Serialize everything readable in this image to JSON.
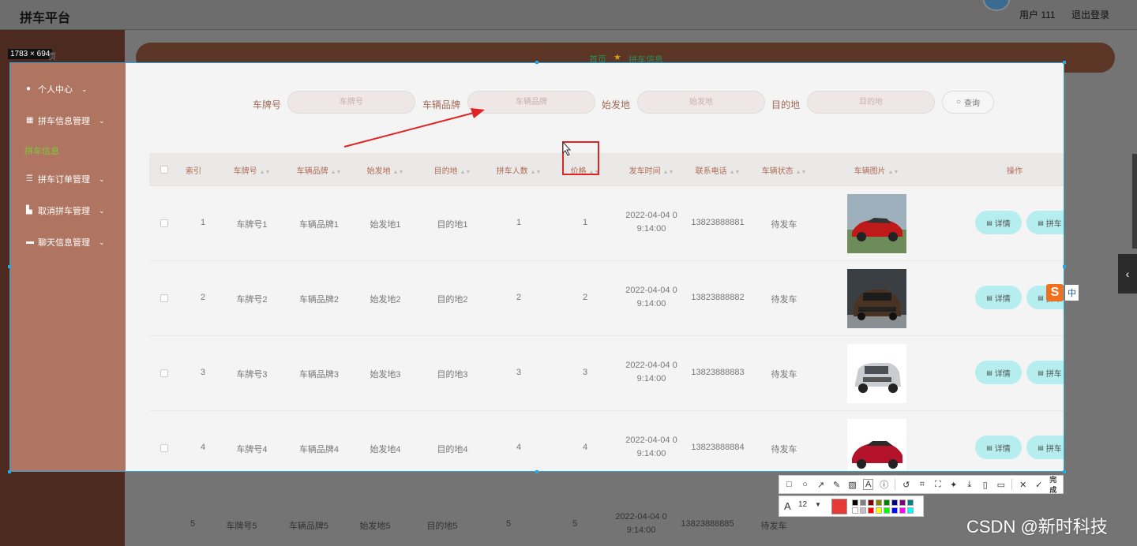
{
  "app": {
    "title": "拼车平台",
    "user": "用户 111",
    "logout": "退出登录"
  },
  "screenshot": {
    "size_label": "1783 × 694",
    "hidden_label": "页"
  },
  "breadcrumb": {
    "home": "首页",
    "current": "拼车信息"
  },
  "sidebar": {
    "items": [
      {
        "label": "个人中心",
        "icon": "user-icon"
      },
      {
        "label": "拼车信息管理",
        "icon": "grid-icon"
      },
      {
        "label": "拼车订单管理",
        "icon": "sliders-icon"
      },
      {
        "label": "取消拼车管理",
        "icon": "thumb-icon"
      },
      {
        "label": "聊天信息管理",
        "icon": "briefcase-icon"
      }
    ],
    "sub_active": "拼车信息"
  },
  "search": {
    "plate_label": "车牌号",
    "plate_placeholder": "车牌号",
    "brand_label": "车辆品牌",
    "brand_placeholder": "车辆品牌",
    "origin_label": "始发地",
    "origin_placeholder": "始发地",
    "dest_label": "目的地",
    "dest_placeholder": "目的地",
    "query_button": "查询"
  },
  "table": {
    "headers": [
      "索引",
      "车牌号",
      "车辆品牌",
      "始发地",
      "目的地",
      "拼车人数",
      "价格",
      "发车时间",
      "联系电话",
      "车辆状态",
      "车辆图片",
      "操作"
    ],
    "rows": [
      {
        "index": "1",
        "plate": "车牌号1",
        "brand": "车辆品牌1",
        "origin": "始发地1",
        "dest": "目的地1",
        "people": "1",
        "price": "1",
        "time1": "2022-04-04 0",
        "time2": "9:14:00",
        "phone": "13823888881",
        "status": "待发车",
        "car": "red-sports-car"
      },
      {
        "index": "2",
        "plate": "车牌号2",
        "brand": "车辆品牌2",
        "origin": "始发地2",
        "dest": "目的地2",
        "people": "2",
        "price": "2",
        "time1": "2022-04-04 0",
        "time2": "9:14:00",
        "phone": "13823888882",
        "status": "待发车",
        "car": "brown-sedan"
      },
      {
        "index": "3",
        "plate": "车牌号3",
        "brand": "车辆品牌3",
        "origin": "始发地3",
        "dest": "目的地3",
        "people": "3",
        "price": "3",
        "time1": "2022-04-04 0",
        "time2": "9:14:00",
        "phone": "13823888883",
        "status": "待发车",
        "car": "silver-suv"
      },
      {
        "index": "4",
        "plate": "车牌号4",
        "brand": "车辆品牌4",
        "origin": "始发地4",
        "dest": "目的地4",
        "people": "4",
        "price": "4",
        "time1": "2022-04-04 0",
        "time2": "9:14:00",
        "phone": "13823888884",
        "status": "待发车",
        "car": "red-sedan"
      }
    ],
    "row5": {
      "index": "5",
      "plate": "车牌号5",
      "brand": "车辆品牌5",
      "origin": "始发地5",
      "dest": "目的地5",
      "people": "5",
      "price": "5",
      "time1": "2022-04-04 0",
      "time2": "9:14:00",
      "phone": "13823888885",
      "status": "待发车"
    },
    "detail_button": "详情",
    "carpool_button": "拼车"
  },
  "annotation_toolbar": {
    "done_label": "完成",
    "font_size": "12",
    "current_color": "#e53935",
    "palette": [
      "#000000",
      "#808080",
      "#800000",
      "#808000",
      "#008000",
      "#000080",
      "#800080",
      "#008080",
      "#ffffff",
      "#c0c0c0",
      "#ff0000",
      "#ffff00",
      "#00ff00",
      "#0000ff",
      "#ff00ff",
      "#00ffff"
    ]
  },
  "ime": {
    "label": "中"
  },
  "watermark": "CSDN @新时科技",
  "colors": {
    "brand_side": "#b07561",
    "accent_button": "#b6eef0",
    "selection_border": "#2aa7e0",
    "annotation_red": "#e02424"
  }
}
